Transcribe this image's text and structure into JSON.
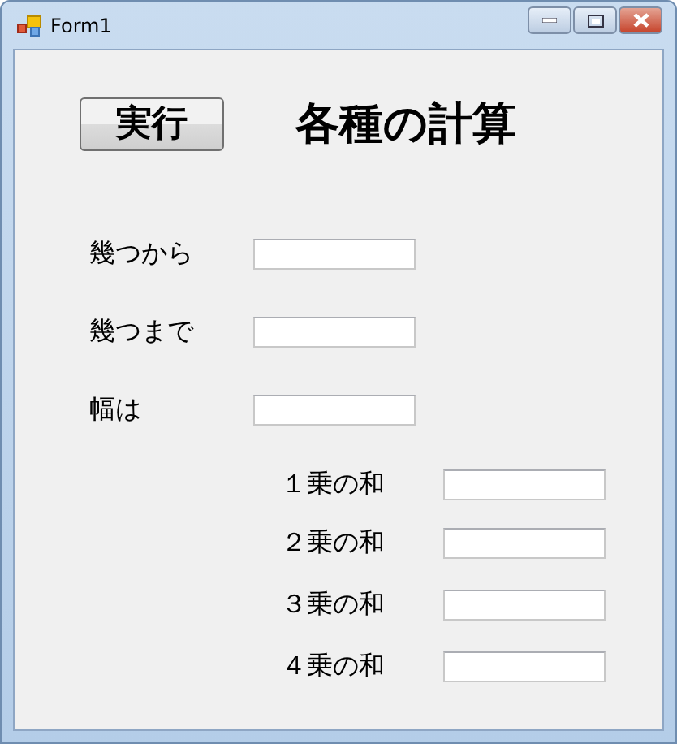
{
  "window": {
    "title": "Form1"
  },
  "run_button": {
    "label": "実行"
  },
  "heading": "各種の計算",
  "inputs": [
    {
      "label": "幾つから"
    },
    {
      "label": "幾つまで"
    },
    {
      "label": "幅は"
    }
  ],
  "results": [
    {
      "label": "１乗の和"
    },
    {
      "label": "２乗の和"
    },
    {
      "label": "３乗の和"
    },
    {
      "label": "４乗の和"
    }
  ]
}
